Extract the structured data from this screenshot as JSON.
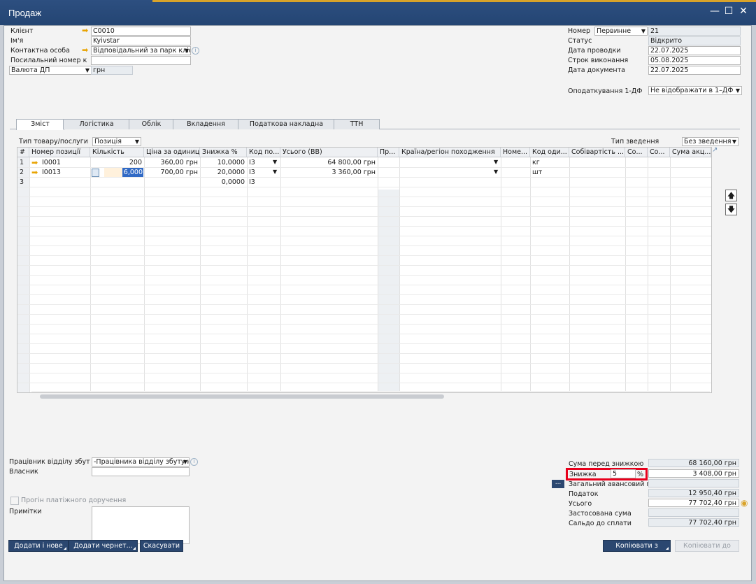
{
  "window": {
    "title": "Продаж"
  },
  "header_left": {
    "client_label": "Клієнт",
    "client_value": "C0010",
    "name_label": "Ім'я",
    "name_value": "Kyivstar",
    "contact_label": "Контактна особа",
    "contact_value": "Відповідальний за парк клієнт",
    "ref_label": "Посилальний номер к",
    "ref_value": "",
    "currency_label": "Валюта ДП",
    "currency_value": "грн"
  },
  "header_right": {
    "number_label": "Номер",
    "series_value": "Первинне",
    "number_value": "21",
    "status_label": "Статус",
    "status_value": "Відкрито",
    "posting_label": "Дата проводки",
    "posting_value": "22.07.2025",
    "due_label": "Строк виконання",
    "due_value": "05.08.2025",
    "docdate_label": "Дата документа",
    "docdate_value": "22.07.2025",
    "tax_label": "Оподаткування 1-ДФ",
    "tax_value": "Не відображати в 1–ДФ"
  },
  "tabs": [
    "Зміст",
    "Логістика",
    "Облік",
    "Вкладення",
    "Податкова накладна",
    "ТТН"
  ],
  "content": {
    "item_type_label": "Тип товару/послуги",
    "item_type_value": "Позиція",
    "summary_label": "Тип зведення",
    "summary_value": "Без зведення"
  },
  "grid": {
    "columns": [
      "#",
      "Номер позиції",
      "Кількість",
      "Ціна за одиницю",
      "Знижка %",
      "Код по...",
      "Усього (ВВ)",
      "Пр...",
      "Країна/регіон походження",
      "Номе...",
      "Код оди...",
      "Собівартість ...",
      "Со...",
      "Со...",
      "Сума акц..."
    ],
    "rows": [
      {
        "num": "1",
        "item": "I0001",
        "qty": "200",
        "price": "360,00 грн",
        "disc": "10,0000",
        "tax": "I3",
        "total": "64 800,00 грн",
        "uom": "кг"
      },
      {
        "num": "2",
        "item": "I0013",
        "qty": "6,000",
        "price": "700,00 грн",
        "disc": "20,0000",
        "tax": "I3",
        "total": "3 360,00 грн",
        "uom": "шт"
      },
      {
        "num": "3",
        "item": "",
        "qty": "",
        "price": "",
        "disc": "0,0000",
        "tax": "I3",
        "total": "",
        "uom": ""
      }
    ]
  },
  "footer_left": {
    "sales_emp_label": "Працівник відділу збут",
    "sales_emp_value": "-Працівника відділу збуту нем",
    "owner_label": "Власник",
    "owner_value": "",
    "payment_label": "Прогін платіжного доручення",
    "remarks_label": "Примітки"
  },
  "totals": {
    "before_disc_label": "Сума перед знижкою",
    "before_disc_value": "68 160,00 грн",
    "disc_label": "Знижка",
    "disc_pct": "5",
    "disc_pct_sign": "%",
    "disc_value": "3 408,00 грн",
    "advance_label": "Загальний авансовий пл",
    "advance_value": "",
    "tax_label": "Податок",
    "tax_value": "12 950,40 грн",
    "total_label": "Усього",
    "total_value": "77 702,40 грн",
    "applied_label": "Застосована сума",
    "applied_value": "",
    "balance_label": "Сальдо до сплати",
    "balance_value": "77 702,40 грн"
  },
  "buttons": {
    "add_new": "Додати і нове",
    "add_draft": "Додати чернет...",
    "cancel": "Скасувати",
    "copy_from": "Копіювати з",
    "copy_to": "Копіювати до"
  },
  "colors": {
    "titlebar": "#2b4a78",
    "accent_arrow": "#e8a300",
    "highlight_box": "#e8001c"
  }
}
